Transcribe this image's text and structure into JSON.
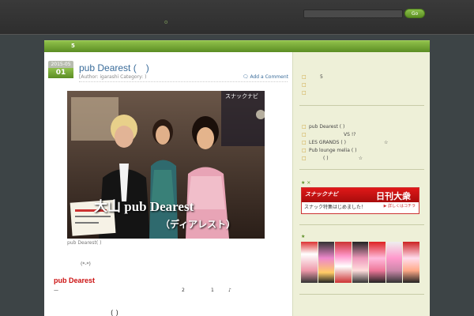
{
  "header": {
    "dot": "o",
    "search_placeholder": "",
    "search_button": "Go"
  },
  "nav": {
    "number": "5"
  },
  "post": {
    "date_top": "2015-05",
    "date_day": "01",
    "title": "pub Dearest (　)",
    "meta": "[Author: igarashi  Category:                )",
    "comment_link": "Add a Comment",
    "photo_overlay_tag": "スナックナビ",
    "photo_overlay_title": "大山 pub Dearest",
    "photo_overlay_sub": "（ディアレスト）",
    "caption": "pub Dearest(  )",
    "smile": "(*-*)",
    "red_heading": "pub Dearest",
    "body_line": {
      "dash": "—",
      "n1": "2",
      "n2": "1",
      "note": "♪"
    },
    "bottom_paren": "( )"
  },
  "sidebar": {
    "list1": [
      {
        "text": "5",
        "indent": true
      },
      {
        "text": ""
      },
      {
        "text": ""
      }
    ],
    "list2": [
      {
        "text": "pub Dearest (  )"
      },
      {
        "text": "VS    !?"
      },
      {
        "text": "LES GRANDS (  )",
        "tail": "☆"
      },
      {
        "text": "Pub lounge melia (  )"
      },
      {
        "text": "(   )",
        "tail": "☆"
      }
    ],
    "star1": "★  ×",
    "star2": "★",
    "banner": {
      "logo": "スナックナビ",
      "title": "日刊大衆",
      "bottom_text": "スナック特集はじめました！",
      "bottom_link": "▶ 詳しくはコチラ"
    },
    "colors": {
      "accent": "#5b8d23",
      "link": "#3a6c9a",
      "red": "#cc1111"
    }
  }
}
